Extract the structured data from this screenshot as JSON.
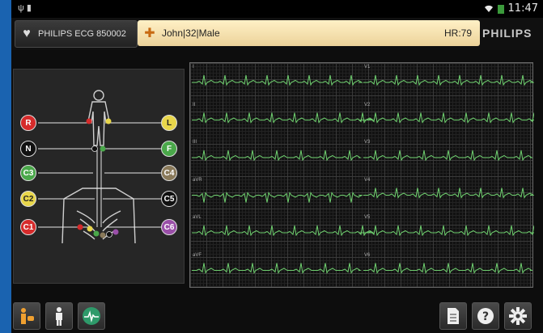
{
  "status_bar": {
    "time": "11:47",
    "usb_glyph": "ψ",
    "battery_glyph": "▮"
  },
  "header": {
    "device_name": "PHILIPS ECG 850002",
    "patient": "John|32|Male",
    "heart_rate": "HR:79",
    "brand": "PHILIPS"
  },
  "electrodes": [
    {
      "label": "R",
      "color": "#d62b2b",
      "text": "#fff"
    },
    {
      "label": "N",
      "color": "#111111",
      "text": "#fff"
    },
    {
      "label": "C3",
      "color": "#4aa84a",
      "text": "#fff"
    },
    {
      "label": "C2",
      "color": "#e8d64a",
      "text": "#222"
    },
    {
      "label": "C1",
      "color": "#d62b2b",
      "text": "#fff"
    },
    {
      "label": "L",
      "color": "#e8d64a",
      "text": "#222"
    },
    {
      "label": "F",
      "color": "#4aa84a",
      "text": "#fff"
    },
    {
      "label": "C4",
      "color": "#8a7a5a",
      "text": "#fff"
    },
    {
      "label": "C5",
      "color": "#111111",
      "text": "#fff"
    },
    {
      "label": "C6",
      "color": "#9a4fa8",
      "text": "#fff"
    }
  ],
  "leads": [
    "I",
    "II",
    "III",
    "aVR",
    "aVL",
    "aVF",
    "V1",
    "V2",
    "V3",
    "V4",
    "V5",
    "V6"
  ],
  "trace_color": "#6fd06f",
  "icons": [
    "usb-icon",
    "battery-icon",
    "wifi-icon",
    "heart-icon",
    "patient-icon",
    "person-icon",
    "ecg-icon",
    "report-icon",
    "help-icon",
    "gear-icon"
  ]
}
